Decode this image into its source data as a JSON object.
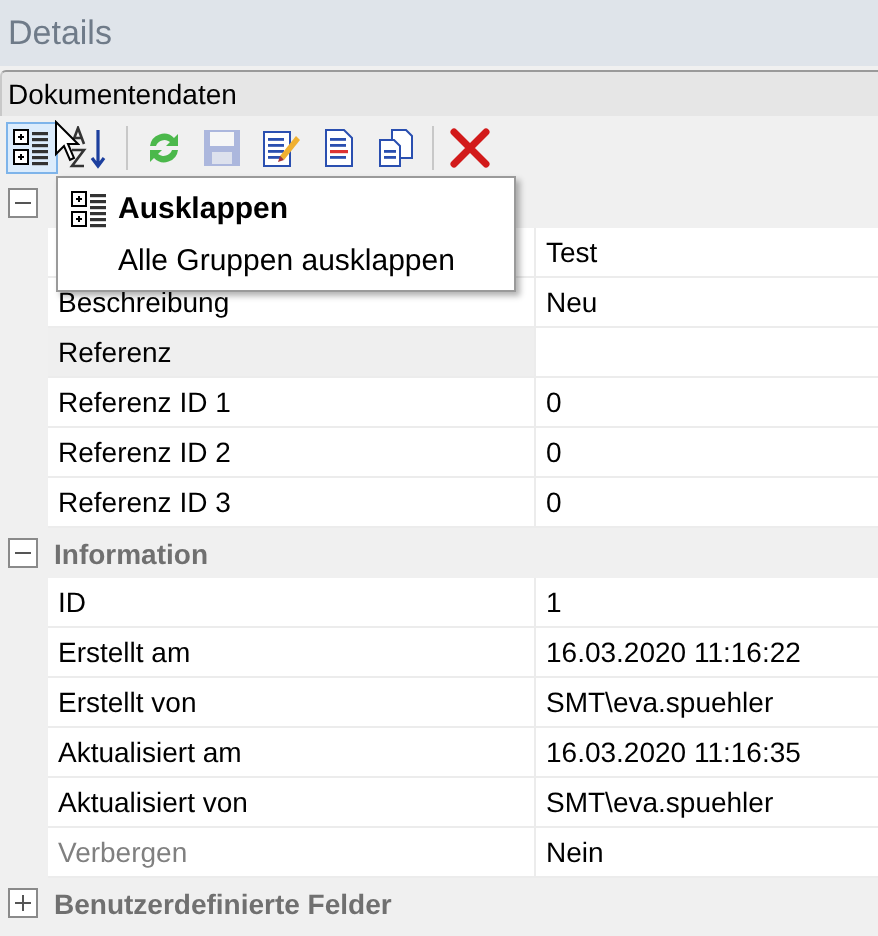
{
  "window": {
    "title": "Details"
  },
  "panel": {
    "title": "Dokumentendaten"
  },
  "toolbar": [
    {
      "kind": "expand",
      "hovered": true,
      "disabled": false
    },
    {
      "kind": "sort",
      "hovered": false,
      "disabled": false
    },
    {
      "kind": "separator"
    },
    {
      "kind": "refresh",
      "hovered": false,
      "disabled": false
    },
    {
      "kind": "save",
      "hovered": false,
      "disabled": true
    },
    {
      "kind": "edit",
      "hovered": false,
      "disabled": false
    },
    {
      "kind": "document",
      "hovered": false,
      "disabled": false
    },
    {
      "kind": "copy",
      "hovered": false,
      "disabled": false
    },
    {
      "kind": "separator"
    },
    {
      "kind": "delete",
      "hovered": false,
      "disabled": false
    }
  ],
  "tooltip": {
    "title": "Ausklappen",
    "text": "Alle Gruppen ausklappen"
  },
  "groups": [
    {
      "expanded": true,
      "rows": [
        {
          "value": "Test"
        },
        {
          "label": "Beschreibung",
          "value": "Neu",
          "selected": false,
          "disabled": false
        },
        {
          "label": "Referenz",
          "selected": true,
          "disabled": false
        },
        {
          "label": "Referenz ID 1",
          "value": "0",
          "selected": false,
          "disabled": false
        },
        {
          "label": "Referenz ID 2",
          "value": "0",
          "selected": false,
          "disabled": false
        },
        {
          "label": "Referenz ID 3",
          "value": "0",
          "selected": false,
          "disabled": false
        }
      ]
    },
    {
      "label": "Information",
      "expanded": true,
      "rows": [
        {
          "label": "ID",
          "value": "1",
          "selected": false,
          "disabled": false
        },
        {
          "label": "Erstellt am",
          "value": "16.03.2020 11:16:22",
          "selected": false,
          "disabled": false
        },
        {
          "label": "Erstellt von",
          "value": "SMT\\eva.spuehler",
          "selected": false,
          "disabled": false
        },
        {
          "label": "Aktualisiert am",
          "value": "16.03.2020 11:16:35",
          "selected": false,
          "disabled": false
        },
        {
          "label": "Aktualisiert von",
          "value": "SMT\\eva.spuehler",
          "selected": false,
          "disabled": false
        },
        {
          "label": "Verbergen",
          "value": "Nein",
          "selected": false,
          "disabled": true
        }
      ]
    },
    {
      "label": "Benutzerdefinierte Felder",
      "expanded": false
    }
  ]
}
